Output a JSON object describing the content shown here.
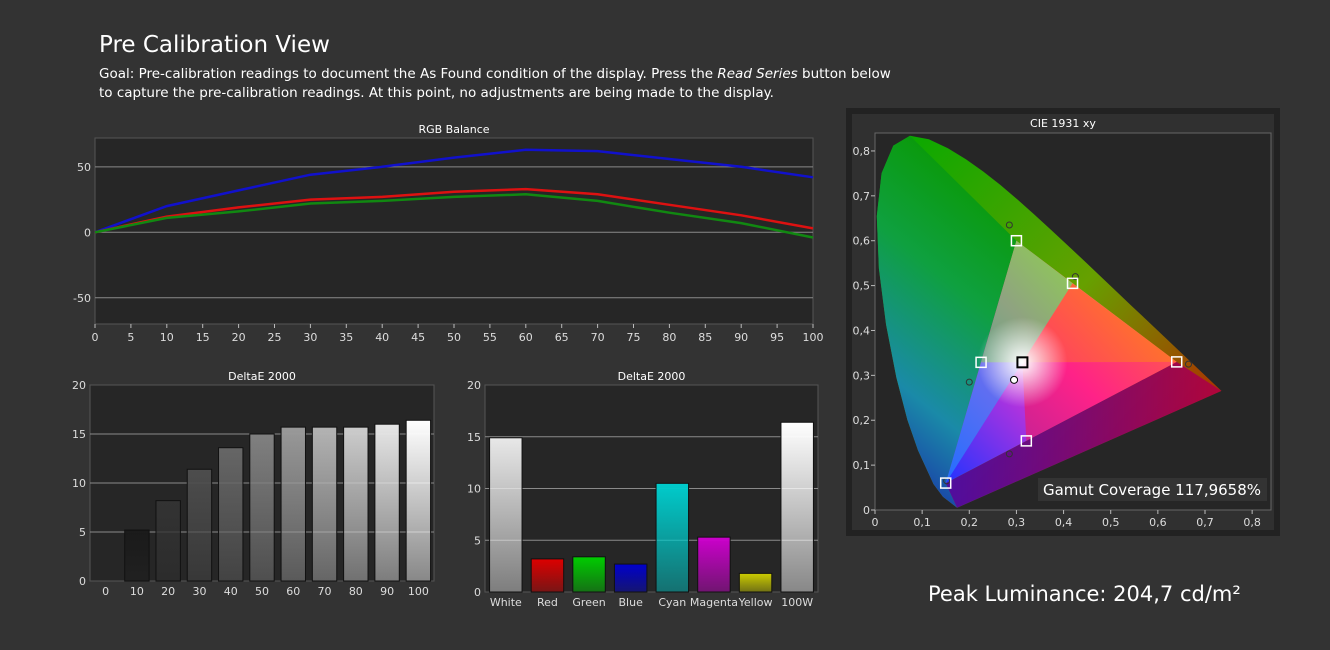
{
  "header": {
    "title": "Pre Calibration View",
    "goal_prefix": "Goal: Pre-calibration readings to document the As Found condition of the display. Press the ",
    "goal_emphasis": "Read Series",
    "goal_suffix": " button below to capture the pre-calibration readings. At this point, no adjustments are being made to the display."
  },
  "peak_luminance": "Peak Luminance: 204,7 cd/m²",
  "colors": {
    "background": "#333333",
    "plot_background": "#262626",
    "grid": "#8a8a8a",
    "red": "#dd1111",
    "green": "#118811",
    "blue": "#1111cc"
  },
  "chart_data": [
    {
      "id": "rgb-balance",
      "type": "line",
      "title": "RGB Balance",
      "x": [
        0,
        10,
        20,
        30,
        40,
        50,
        60,
        70,
        80,
        90,
        100
      ],
      "xticks": [
        0,
        5,
        10,
        15,
        20,
        25,
        30,
        35,
        40,
        45,
        50,
        55,
        60,
        65,
        70,
        75,
        80,
        85,
        90,
        95,
        100
      ],
      "xlim": [
        0,
        100
      ],
      "ylim": [
        -70,
        72
      ],
      "yticks": [
        -50,
        0,
        50
      ],
      "grid": true,
      "series": [
        {
          "key": "blue",
          "color": "#1111cc",
          "values": [
            0,
            20,
            32,
            44,
            50,
            57,
            63,
            62,
            56,
            50,
            42
          ]
        },
        {
          "key": "red",
          "color": "#dd1111",
          "values": [
            0,
            12,
            19,
            25,
            27,
            31,
            33,
            29,
            21,
            13,
            3
          ]
        },
        {
          "key": "green",
          "color": "#118811",
          "values": [
            0,
            11,
            16,
            22,
            24,
            27,
            29,
            24,
            15,
            7,
            -4
          ]
        }
      ]
    },
    {
      "id": "deltae-grayscale",
      "type": "bar",
      "title": "DeltaE 2000",
      "categories": [
        "0",
        "10",
        "20",
        "30",
        "40",
        "50",
        "60",
        "70",
        "80",
        "90",
        "100"
      ],
      "values": [
        0,
        5.2,
        8.2,
        11.4,
        13.6,
        15.0,
        15.7,
        15.7,
        15.7,
        16.0,
        16.4
      ],
      "bar_colors": [
        "#000000",
        "#1a1a1a",
        "#333333",
        "#4d4d4d",
        "#666666",
        "#808080",
        "#999999",
        "#b3b3b3",
        "#cccccc",
        "#e6e6e6",
        "#ffffff"
      ],
      "ylim": [
        0,
        20
      ],
      "yticks": [
        0,
        5,
        10,
        15,
        20
      ],
      "grid": true
    },
    {
      "id": "deltae-colors",
      "type": "bar",
      "title": "DeltaE 2000",
      "categories": [
        "White",
        "Red",
        "Green",
        "Blue",
        "Cyan",
        "Magenta",
        "Yellow",
        "100W"
      ],
      "values": [
        14.9,
        3.2,
        3.4,
        2.7,
        10.5,
        5.3,
        1.8,
        16.4
      ],
      "bar_colors": [
        "#e8e8e8",
        "#dd0000",
        "#00cc00",
        "#0000cc",
        "#00cccc",
        "#cc00cc",
        "#cccc00",
        "#ffffff"
      ],
      "ylim": [
        0,
        20
      ],
      "yticks": [
        0,
        5,
        10,
        15,
        20
      ],
      "grid": true
    },
    {
      "id": "cie-1931",
      "type": "scatter",
      "title": "CIE 1931 xy",
      "xlim": [
        0,
        0.84
      ],
      "ylim": [
        0,
        0.84
      ],
      "xticks": [
        "0",
        "0,1",
        "0,2",
        "0,3",
        "0,4",
        "0,5",
        "0,6",
        "0,7",
        "0,8"
      ],
      "yticks": [
        "0",
        "0,1",
        "0,2",
        "0,3",
        "0,4",
        "0,5",
        "0,6",
        "0,7",
        "0,8"
      ],
      "gamut_coverage": "Gamut Coverage 117,9658%",
      "targets": [
        {
          "name": "Red",
          "x": 0.64,
          "y": 0.33
        },
        {
          "name": "Green",
          "x": 0.3,
          "y": 0.6
        },
        {
          "name": "Blue",
          "x": 0.15,
          "y": 0.06
        },
        {
          "name": "Cyan",
          "x": 0.225,
          "y": 0.329
        },
        {
          "name": "Magenta",
          "x": 0.321,
          "y": 0.154
        },
        {
          "name": "Yellow",
          "x": 0.419,
          "y": 0.505
        },
        {
          "name": "White",
          "x": 0.3127,
          "y": 0.329
        }
      ],
      "measured": [
        {
          "name": "Red",
          "x": 0.665,
          "y": 0.325
        },
        {
          "name": "Green",
          "x": 0.285,
          "y": 0.635
        },
        {
          "name": "Blue",
          "x": 0.152,
          "y": 0.065
        },
        {
          "name": "Cyan",
          "x": 0.2,
          "y": 0.285
        },
        {
          "name": "Magenta",
          "x": 0.285,
          "y": 0.125
        },
        {
          "name": "Yellow",
          "x": 0.425,
          "y": 0.52
        },
        {
          "name": "White",
          "x": 0.295,
          "y": 0.29
        }
      ]
    }
  ]
}
